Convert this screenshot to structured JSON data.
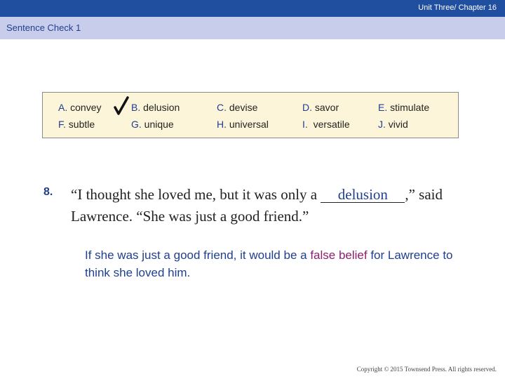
{
  "header": {
    "chapter": "Unit Three/ Chapter 16",
    "section_title": "Sentence Check 1"
  },
  "word_box": {
    "options": [
      {
        "letter": "A.",
        "word": "convey"
      },
      {
        "letter": "B.",
        "word": "delusion"
      },
      {
        "letter": "C.",
        "word": "devise"
      },
      {
        "letter": "D.",
        "word": "savor"
      },
      {
        "letter": "E.",
        "word": "stimulate"
      },
      {
        "letter": "F.",
        "word": "subtle"
      },
      {
        "letter": "G.",
        "word": "unique"
      },
      {
        "letter": "H.",
        "word": "universal"
      },
      {
        "letter": "I.",
        "word": "versatile"
      },
      {
        "letter": "J.",
        "word": "vivid"
      }
    ],
    "checked_icon": "checkmark-icon"
  },
  "question": {
    "number": "8.",
    "before": "“I thought she loved me, but it was only a ",
    "answer": "delusion",
    "after": ",” said Lawrence. “She was just a good friend.”"
  },
  "explanation": {
    "before": "If she was just a good friend, it would be a ",
    "highlight": "false belief",
    "after": " for Lawrence to think she loved him."
  },
  "footer": {
    "copyright": "Copyright © 2015 Townsend Press. All rights reserved."
  },
  "colors": {
    "header_bar": "#1f4f9e",
    "subheader_bar": "#c9cdec",
    "accent": "#1f3f8e",
    "highlight": "#8b1f6e",
    "box_fill": "#fdf5d9"
  }
}
